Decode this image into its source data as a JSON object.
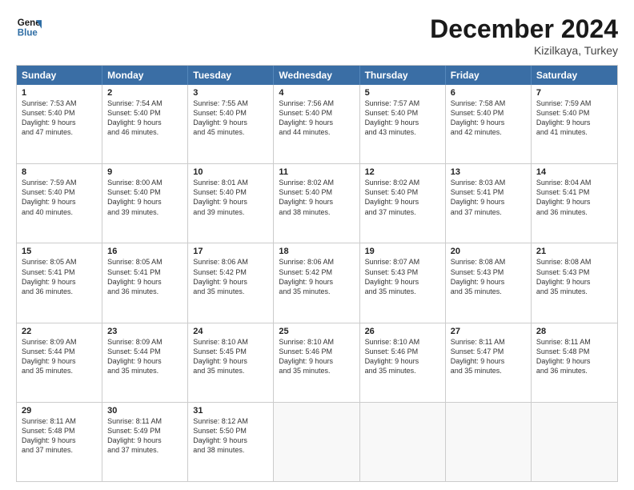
{
  "header": {
    "logo_line1": "General",
    "logo_line2": "Blue",
    "month": "December 2024",
    "location": "Kizilkaya, Turkey"
  },
  "weekdays": [
    "Sunday",
    "Monday",
    "Tuesday",
    "Wednesday",
    "Thursday",
    "Friday",
    "Saturday"
  ],
  "weeks": [
    [
      {
        "day": "1",
        "lines": [
          "Sunrise: 7:53 AM",
          "Sunset: 5:40 PM",
          "Daylight: 9 hours",
          "and 47 minutes."
        ]
      },
      {
        "day": "2",
        "lines": [
          "Sunrise: 7:54 AM",
          "Sunset: 5:40 PM",
          "Daylight: 9 hours",
          "and 46 minutes."
        ]
      },
      {
        "day": "3",
        "lines": [
          "Sunrise: 7:55 AM",
          "Sunset: 5:40 PM",
          "Daylight: 9 hours",
          "and 45 minutes."
        ]
      },
      {
        "day": "4",
        "lines": [
          "Sunrise: 7:56 AM",
          "Sunset: 5:40 PM",
          "Daylight: 9 hours",
          "and 44 minutes."
        ]
      },
      {
        "day": "5",
        "lines": [
          "Sunrise: 7:57 AM",
          "Sunset: 5:40 PM",
          "Daylight: 9 hours",
          "and 43 minutes."
        ]
      },
      {
        "day": "6",
        "lines": [
          "Sunrise: 7:58 AM",
          "Sunset: 5:40 PM",
          "Daylight: 9 hours",
          "and 42 minutes."
        ]
      },
      {
        "day": "7",
        "lines": [
          "Sunrise: 7:59 AM",
          "Sunset: 5:40 PM",
          "Daylight: 9 hours",
          "and 41 minutes."
        ]
      }
    ],
    [
      {
        "day": "8",
        "lines": [
          "Sunrise: 7:59 AM",
          "Sunset: 5:40 PM",
          "Daylight: 9 hours",
          "and 40 minutes."
        ]
      },
      {
        "day": "9",
        "lines": [
          "Sunrise: 8:00 AM",
          "Sunset: 5:40 PM",
          "Daylight: 9 hours",
          "and 39 minutes."
        ]
      },
      {
        "day": "10",
        "lines": [
          "Sunrise: 8:01 AM",
          "Sunset: 5:40 PM",
          "Daylight: 9 hours",
          "and 39 minutes."
        ]
      },
      {
        "day": "11",
        "lines": [
          "Sunrise: 8:02 AM",
          "Sunset: 5:40 PM",
          "Daylight: 9 hours",
          "and 38 minutes."
        ]
      },
      {
        "day": "12",
        "lines": [
          "Sunrise: 8:02 AM",
          "Sunset: 5:40 PM",
          "Daylight: 9 hours",
          "and 37 minutes."
        ]
      },
      {
        "day": "13",
        "lines": [
          "Sunrise: 8:03 AM",
          "Sunset: 5:41 PM",
          "Daylight: 9 hours",
          "and 37 minutes."
        ]
      },
      {
        "day": "14",
        "lines": [
          "Sunrise: 8:04 AM",
          "Sunset: 5:41 PM",
          "Daylight: 9 hours",
          "and 36 minutes."
        ]
      }
    ],
    [
      {
        "day": "15",
        "lines": [
          "Sunrise: 8:05 AM",
          "Sunset: 5:41 PM",
          "Daylight: 9 hours",
          "and 36 minutes."
        ]
      },
      {
        "day": "16",
        "lines": [
          "Sunrise: 8:05 AM",
          "Sunset: 5:41 PM",
          "Daylight: 9 hours",
          "and 36 minutes."
        ]
      },
      {
        "day": "17",
        "lines": [
          "Sunrise: 8:06 AM",
          "Sunset: 5:42 PM",
          "Daylight: 9 hours",
          "and 35 minutes."
        ]
      },
      {
        "day": "18",
        "lines": [
          "Sunrise: 8:06 AM",
          "Sunset: 5:42 PM",
          "Daylight: 9 hours",
          "and 35 minutes."
        ]
      },
      {
        "day": "19",
        "lines": [
          "Sunrise: 8:07 AM",
          "Sunset: 5:43 PM",
          "Daylight: 9 hours",
          "and 35 minutes."
        ]
      },
      {
        "day": "20",
        "lines": [
          "Sunrise: 8:08 AM",
          "Sunset: 5:43 PM",
          "Daylight: 9 hours",
          "and 35 minutes."
        ]
      },
      {
        "day": "21",
        "lines": [
          "Sunrise: 8:08 AM",
          "Sunset: 5:43 PM",
          "Daylight: 9 hours",
          "and 35 minutes."
        ]
      }
    ],
    [
      {
        "day": "22",
        "lines": [
          "Sunrise: 8:09 AM",
          "Sunset: 5:44 PM",
          "Daylight: 9 hours",
          "and 35 minutes."
        ]
      },
      {
        "day": "23",
        "lines": [
          "Sunrise: 8:09 AM",
          "Sunset: 5:44 PM",
          "Daylight: 9 hours",
          "and 35 minutes."
        ]
      },
      {
        "day": "24",
        "lines": [
          "Sunrise: 8:10 AM",
          "Sunset: 5:45 PM",
          "Daylight: 9 hours",
          "and 35 minutes."
        ]
      },
      {
        "day": "25",
        "lines": [
          "Sunrise: 8:10 AM",
          "Sunset: 5:46 PM",
          "Daylight: 9 hours",
          "and 35 minutes."
        ]
      },
      {
        "day": "26",
        "lines": [
          "Sunrise: 8:10 AM",
          "Sunset: 5:46 PM",
          "Daylight: 9 hours",
          "and 35 minutes."
        ]
      },
      {
        "day": "27",
        "lines": [
          "Sunrise: 8:11 AM",
          "Sunset: 5:47 PM",
          "Daylight: 9 hours",
          "and 35 minutes."
        ]
      },
      {
        "day": "28",
        "lines": [
          "Sunrise: 8:11 AM",
          "Sunset: 5:48 PM",
          "Daylight: 9 hours",
          "and 36 minutes."
        ]
      }
    ],
    [
      {
        "day": "29",
        "lines": [
          "Sunrise: 8:11 AM",
          "Sunset: 5:48 PM",
          "Daylight: 9 hours",
          "and 37 minutes."
        ]
      },
      {
        "day": "30",
        "lines": [
          "Sunrise: 8:11 AM",
          "Sunset: 5:49 PM",
          "Daylight: 9 hours",
          "and 37 minutes."
        ]
      },
      {
        "day": "31",
        "lines": [
          "Sunrise: 8:12 AM",
          "Sunset: 5:50 PM",
          "Daylight: 9 hours",
          "and 38 minutes."
        ]
      },
      {
        "day": "",
        "lines": []
      },
      {
        "day": "",
        "lines": []
      },
      {
        "day": "",
        "lines": []
      },
      {
        "day": "",
        "lines": []
      }
    ]
  ]
}
